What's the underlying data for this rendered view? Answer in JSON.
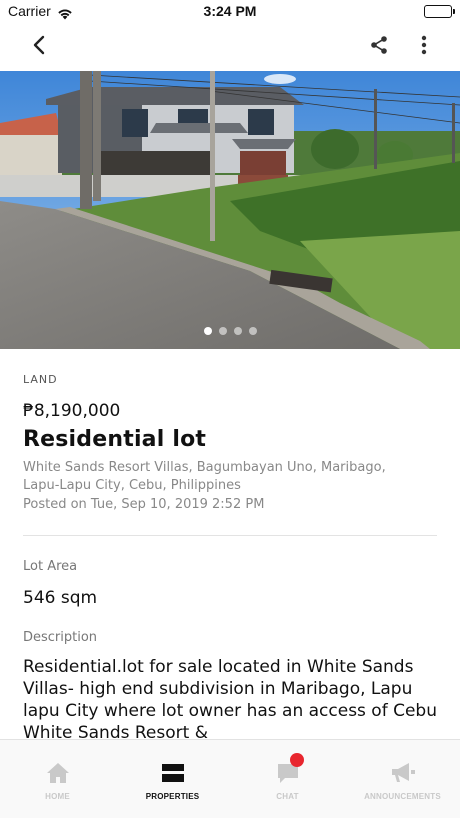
{
  "status_bar": {
    "carrier": "Carrier",
    "time": "3:24 PM",
    "battery_level_percent": 100
  },
  "nav": {
    "back_icon": "chevron-left-icon",
    "share_icon": "share-icon",
    "more_icon": "more-vertical-icon"
  },
  "gallery": {
    "image_count": 4,
    "active_index": 0
  },
  "listing": {
    "category": "LAND",
    "price": "₱8,190,000",
    "title": "Residential lot",
    "address": "White Sands Resort Villas, Bagumbayan Uno, Maribago, Lapu-Lapu City, Cebu, Philippines",
    "posted": "Posted on Tue, Sep 10, 2019 2:52 PM",
    "lot_area_label": "Lot Area",
    "lot_area_value": "546 sqm",
    "description_label": "Description",
    "description": "Residential.lot for sale located in White Sands Villas- high end subdivision  in Maribago, Lapu lapu City where lot owner has an access of Cebu White Sands Resort &"
  },
  "tabs": [
    {
      "label": "HOME",
      "icon": "home-icon",
      "active": false
    },
    {
      "label": "PROPERTIES",
      "icon": "properties-icon",
      "active": true
    },
    {
      "label": "CHAT",
      "icon": "chat-icon",
      "active": false,
      "has_badge": true
    },
    {
      "label": "ANNOUNCEMENTS",
      "icon": "megaphone-icon",
      "active": false
    }
  ],
  "colors": {
    "badge": "#e8262e",
    "inactive_tab": "#c9c9c9",
    "active_tab": "#111111",
    "secondary_text": "#888888"
  }
}
